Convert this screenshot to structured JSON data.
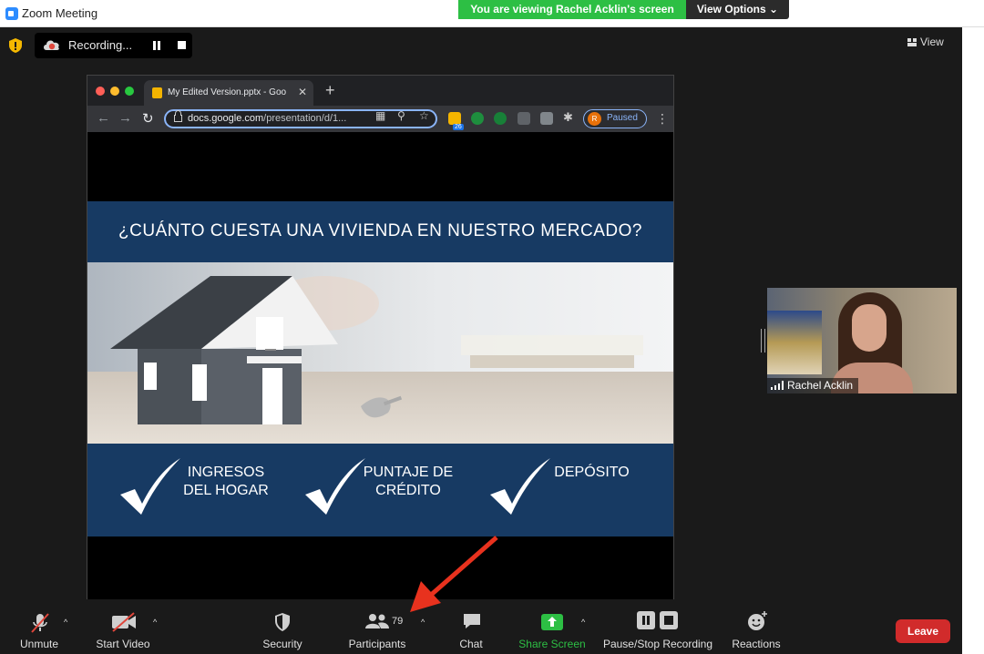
{
  "window": {
    "title": "Zoom Meeting",
    "viewing_banner": "You are viewing Rachel Acklin's screen",
    "view_options": "View Options"
  },
  "meeting": {
    "recording_label": "Recording...",
    "view_label": "View"
  },
  "browser": {
    "tab_title": "My Edited Version.pptx - Goog",
    "url_host": "docs.google.com",
    "url_path": "/presentation/d/1...",
    "extension_badge": "26",
    "profile_initial": "R",
    "profile_status": "Paused"
  },
  "slide": {
    "title": "¿CUÁNTO CUESTA UNA VIVIENDA EN NUESTRO MERCADO?",
    "pillars": [
      {
        "line1": "INGRESOS",
        "line2": "DEL HOGAR"
      },
      {
        "line1": "PUNTAJE DE",
        "line2": "CRÉDITO"
      },
      {
        "line1": "DEPÓSITO",
        "line2": ""
      }
    ]
  },
  "video": {
    "participant_name": "Rachel Acklin"
  },
  "controls": {
    "unmute": "Unmute",
    "start_video": "Start Video",
    "security": "Security",
    "participants": "Participants",
    "participants_count": "79",
    "chat": "Chat",
    "share_screen": "Share Screen",
    "pause_stop_recording": "Pause/Stop Recording",
    "reactions": "Reactions",
    "leave": "Leave"
  },
  "colors": {
    "banner_green": "#2dbf44",
    "slide_navy": "#173a63",
    "leave_red": "#d12b2b",
    "share_green": "#2dbf44",
    "arrow_red": "#e8321e"
  }
}
